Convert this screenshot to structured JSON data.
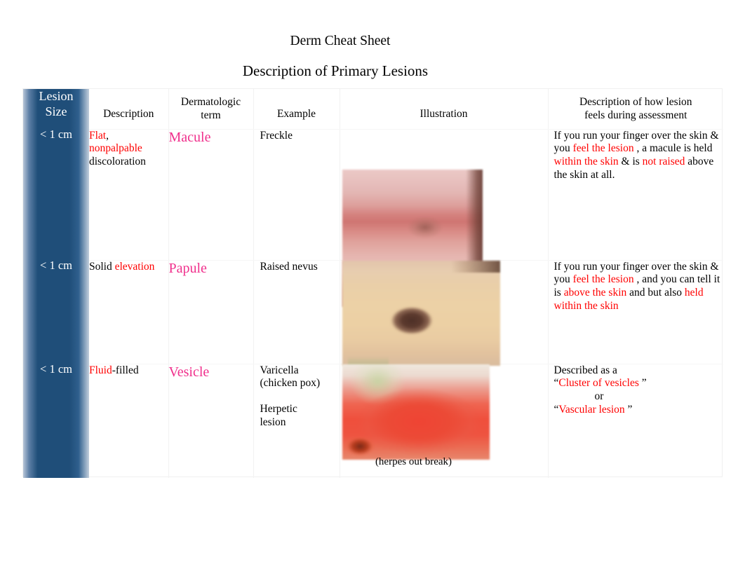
{
  "document": {
    "title": "Derm Cheat Sheet",
    "subtitle": "Description of Primary Lesions"
  },
  "table": {
    "headers": {
      "size": "Lesion Size",
      "size_line1": "Lesion",
      "size_line2": "Size",
      "description": "Description",
      "term_line1": "Dermatologic",
      "term_line2": "term",
      "example": "Example",
      "illustration": "Illustration",
      "feel_line1": "Description of how lesion",
      "feel_line2": "feels during assessment"
    },
    "rows": [
      {
        "size": "< 1 cm",
        "description": {
          "seg1_red": "Flat",
          "seg2_black": ",",
          "seg3_red": "nonpalpable",
          "seg4_black": "discoloration"
        },
        "term": "Macule",
        "example": "Freckle",
        "illustration": {
          "alt": "freckle-macule-skin-photo",
          "caption": ""
        },
        "feel": {
          "p1_black": "If you run your finger over the skin & you",
          "p2_red": "feel the lesion",
          "p3_black": ", a macule is held",
          "p4_red": "within the skin",
          "p5_black": "& is",
          "p6_red": "not raised",
          "p7_black": "above the skin at all."
        }
      },
      {
        "size": "< 1 cm",
        "description": {
          "seg1_black": "Solid",
          "seg2_red": "elevation"
        },
        "term": "Papule",
        "example": "Raised nevus",
        "illustration": {
          "alt": "raised-nevus-skin-photo",
          "caption": ""
        },
        "feel": {
          "p1_black": "If you run your finger over the skin & you",
          "p2_red": "feel the lesion",
          "p3_black": ", and you can tell it is",
          "p4_red": "above the skin",
          "p5_black": "and but also",
          "p6_red": "held within the skin"
        }
      },
      {
        "size": "< 1 cm",
        "description": {
          "seg1_red": "Fluid",
          "seg2_black": "-filled"
        },
        "term": "Vesicle",
        "example_line1": "Varicella",
        "example_line2": "(chicken pox)",
        "example_line3": "Herpetic",
        "example_line4": "lesion",
        "illustration": {
          "alt": "herpetic-vesicle-skin-photo",
          "caption": "(herpes out break)"
        },
        "feel": {
          "p1_black": "Described as a",
          "q_open_1": "“",
          "p2_red": "Cluster of vesicles",
          "q_close_1": "”",
          "p3_black": "or",
          "q_open_2": "“",
          "p4_red": "Vascular lesion",
          "q_close_2": "”"
        }
      }
    ]
  },
  "colors": {
    "accent_blue": "#1f4e79",
    "term_pink": "#f0308c",
    "highlight_red": "#ff0000",
    "text_black": "#000000",
    "page_background": "#ffffff"
  }
}
